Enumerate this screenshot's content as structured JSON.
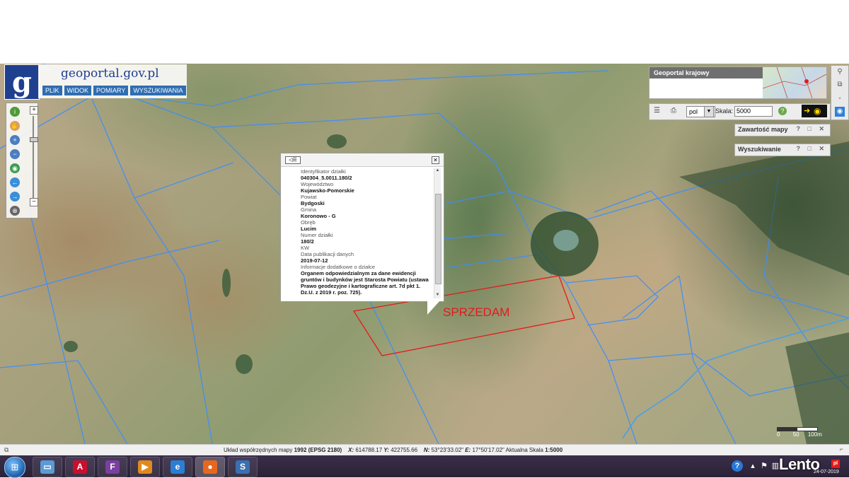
{
  "app": {
    "brand_name": "geoportal.gov.pl",
    "logo_letter": "g",
    "menu": [
      {
        "label": "PLIK"
      },
      {
        "label": "WIDOK"
      },
      {
        "label": "POMIARY"
      },
      {
        "label": "WYSZUKIWANIA"
      }
    ]
  },
  "toolbar": {
    "tools": [
      "info-icon",
      "pan-hand-icon",
      "zoom-in-icon",
      "zoom-out-icon",
      "globe-icon",
      "back-arrow-icon",
      "forward-arrow-icon",
      "clear-icon"
    ],
    "zoom_plus": "+",
    "zoom_minus": "−"
  },
  "overview": {
    "title": "Geoportal krajowy"
  },
  "scale_bar": {
    "language_value": "pol",
    "scale_label": "Skala:",
    "scale_value": "5000"
  },
  "panels": [
    {
      "title": "Zawartość mapy",
      "controls": "? □ ✕"
    },
    {
      "title": "Wyszukiwanie",
      "controls": "? □ ✕"
    }
  ],
  "popup": {
    "fields": [
      {
        "label": "Identyfikator działki",
        "value": "040304_5.0011.180/2"
      },
      {
        "label": "Województwo",
        "value": "Kujawsko-Pomorskie"
      },
      {
        "label": "Powiat",
        "value": "Bydgoski"
      },
      {
        "label": "Gmina",
        "value": "Koronowo - G"
      },
      {
        "label": "Obręb",
        "value": "Lucim"
      },
      {
        "label": "Numer działki",
        "value": "180/2"
      },
      {
        "label": "KW",
        "value": ""
      },
      {
        "label": "Data publikacji danych",
        "value": "2019-07-12"
      },
      {
        "label": "Informacje dodatkowe o działce",
        "value": "Organem odpowiedzialnym za dane ewidencji gruntów i budynków jest Starosta Powiatu (ustawa Prawo geodezyjne i kartograficzne art. 7d pkt 1. Dz.U. z 2019 r. poz. 725)."
      }
    ]
  },
  "annotation": {
    "text": "SPRZEDAM",
    "color": "#e31b1b"
  },
  "map_scale": {
    "labels": [
      "0",
      "50",
      "100m"
    ]
  },
  "status": {
    "system_label": "Układ współrzędnych mapy",
    "system_value": "1992 (EPSG 2180)",
    "x_label": "X:",
    "x_value": "614788.17",
    "y_label": "Y:",
    "y_value": "422755.66",
    "n_label": "N:",
    "n_value": "53°23'33.02\"",
    "e_label": "E:",
    "e_value": "17°50'17.02\"",
    "scale_label": "Aktualna Skala",
    "scale_value": "1:5000"
  },
  "taskbar": {
    "apps": [
      {
        "name": "file-explorer-icon",
        "glyph": "▭",
        "color": "#5a9bd5"
      },
      {
        "name": "acrobat-icon",
        "glyph": "A",
        "color": "#c8102e"
      },
      {
        "name": "app-f-icon",
        "glyph": "F",
        "color": "#7a3fa0"
      },
      {
        "name": "media-player-icon",
        "glyph": "▶",
        "color": "#e08a1e"
      },
      {
        "name": "internet-explorer-icon",
        "glyph": "e",
        "color": "#2a7fd4"
      },
      {
        "name": "firefox-icon",
        "glyph": "●",
        "color": "#e8671e"
      },
      {
        "name": "app-s-icon",
        "glyph": "S",
        "color": "#3a6fb3"
      }
    ],
    "date": "24-07-2019"
  },
  "watermark": {
    "text": "Lento",
    "suffix": "pl"
  }
}
